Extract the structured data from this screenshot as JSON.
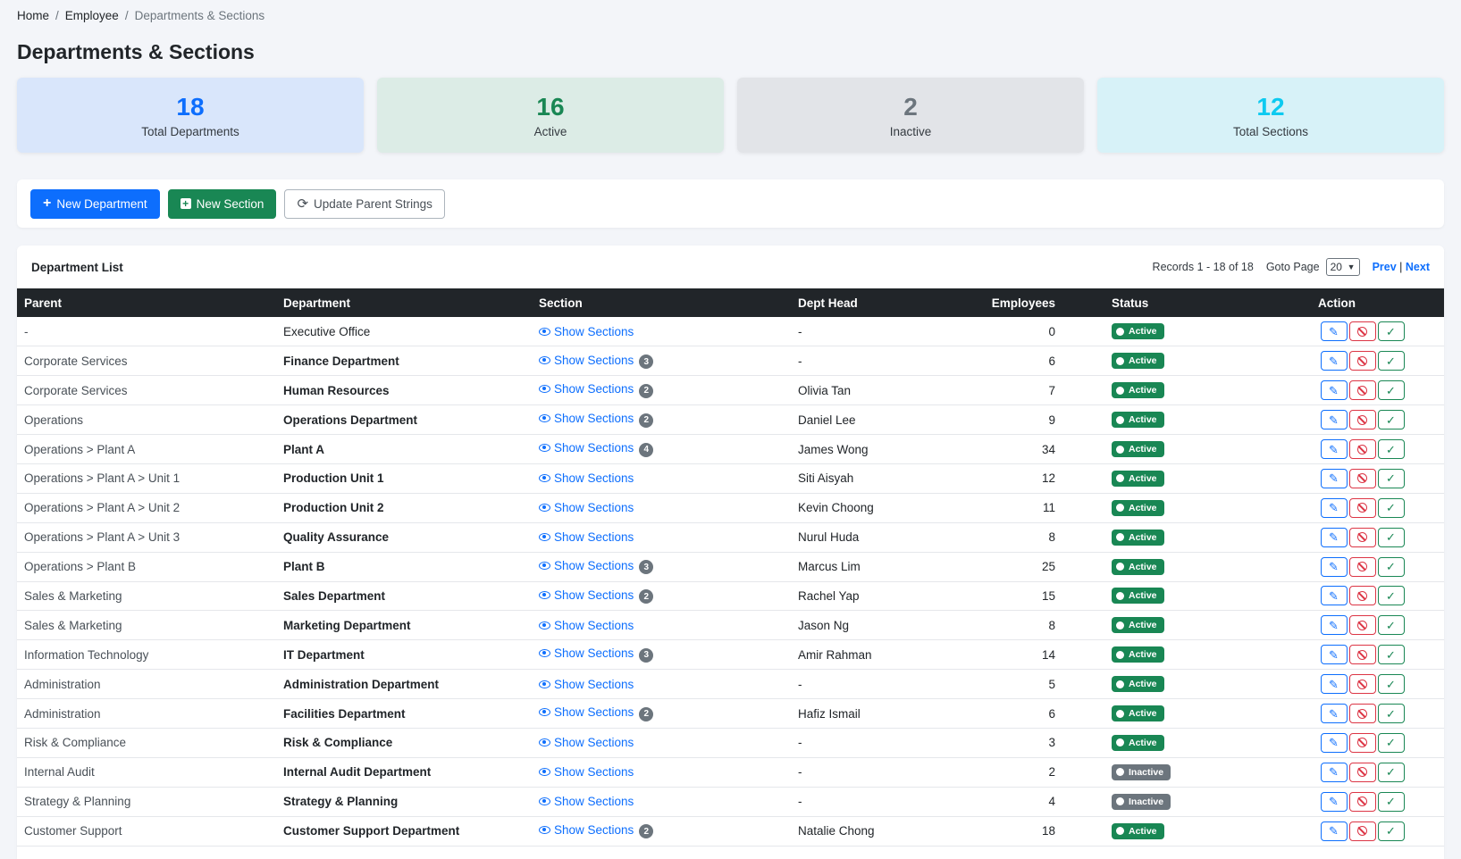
{
  "breadcrumb": {
    "home": "Home",
    "employee": "Employee",
    "current": "Departments & Sections",
    "separator": "/"
  },
  "page_title": "Departments & Sections",
  "stats": [
    {
      "value": "18",
      "label": "Total Departments",
      "color": "#0d6efd"
    },
    {
      "value": "16",
      "label": "Active",
      "color": "#198754"
    },
    {
      "value": "2",
      "label": "Inactive",
      "color": "#6c757d"
    },
    {
      "value": "12",
      "label": "Total Sections",
      "color": "#0dcaf0"
    }
  ],
  "toolbar": {
    "new_department": "New Department",
    "new_section": "New Section",
    "update_parent": "Update Parent Strings"
  },
  "list": {
    "title": "Department List",
    "records": "Records 1 - 18 of 18",
    "goto_label": "Goto Page",
    "page_size": "20",
    "prev": "Prev",
    "pager_sep": "|",
    "next": "Next"
  },
  "columns": {
    "parent": "Parent",
    "department": "Department",
    "section": "Section",
    "dept_head": "Dept Head",
    "employees": "Employees",
    "status": "Status",
    "action": "Action"
  },
  "show_sections_label": "Show Sections",
  "rows": [
    {
      "parent": "-",
      "department": "Executive Office",
      "bold": false,
      "sections": "",
      "head": "-",
      "employees": "0",
      "status": "Active"
    },
    {
      "parent": "Corporate Services",
      "department": "Finance Department",
      "bold": true,
      "sections": "3",
      "head": "-",
      "employees": "6",
      "status": "Active"
    },
    {
      "parent": "Corporate Services",
      "department": "Human Resources",
      "bold": true,
      "sections": "2",
      "head": "Olivia Tan",
      "employees": "7",
      "status": "Active"
    },
    {
      "parent": "Operations",
      "department": "Operations Department",
      "bold": true,
      "sections": "2",
      "head": "Daniel Lee",
      "employees": "9",
      "status": "Active"
    },
    {
      "parent": "Operations > Plant A",
      "department": "Plant A",
      "bold": true,
      "sections": "4",
      "head": "James Wong",
      "employees": "34",
      "status": "Active"
    },
    {
      "parent": "Operations > Plant A > Unit 1",
      "department": "Production Unit 1",
      "bold": true,
      "sections": "",
      "head": "Siti Aisyah",
      "employees": "12",
      "status": "Active"
    },
    {
      "parent": "Operations > Plant A > Unit 2",
      "department": "Production Unit 2",
      "bold": true,
      "sections": "",
      "head": "Kevin Choong",
      "employees": "11",
      "status": "Active"
    },
    {
      "parent": "Operations > Plant A > Unit 3",
      "department": "Quality Assurance",
      "bold": true,
      "sections": "",
      "head": "Nurul Huda",
      "employees": "8",
      "status": "Active"
    },
    {
      "parent": "Operations > Plant B",
      "department": "Plant B",
      "bold": true,
      "sections": "3",
      "head": "Marcus Lim",
      "employees": "25",
      "status": "Active"
    },
    {
      "parent": "Sales & Marketing",
      "department": "Sales Department",
      "bold": true,
      "sections": "2",
      "head": "Rachel Yap",
      "employees": "15",
      "status": "Active"
    },
    {
      "parent": "Sales & Marketing",
      "department": "Marketing Department",
      "bold": true,
      "sections": "",
      "head": "Jason Ng",
      "employees": "8",
      "status": "Active"
    },
    {
      "parent": "Information Technology",
      "department": "IT Department",
      "bold": true,
      "sections": "3",
      "head": "Amir Rahman",
      "employees": "14",
      "status": "Active"
    },
    {
      "parent": "Administration",
      "department": "Administration Department",
      "bold": true,
      "sections": "",
      "head": "-",
      "employees": "5",
      "status": "Active"
    },
    {
      "parent": "Administration",
      "department": "Facilities Department",
      "bold": true,
      "sections": "2",
      "head": "Hafiz Ismail",
      "employees": "6",
      "status": "Active"
    },
    {
      "parent": "Risk & Compliance",
      "department": "Risk & Compliance",
      "bold": true,
      "sections": "",
      "head": "-",
      "employees": "3",
      "status": "Active"
    },
    {
      "parent": "Internal Audit",
      "department": "Internal Audit Department",
      "bold": true,
      "sections": "",
      "head": "-",
      "employees": "2",
      "status": "Inactive"
    },
    {
      "parent": "Strategy & Planning",
      "department": "Strategy & Planning",
      "bold": true,
      "sections": "",
      "head": "-",
      "employees": "4",
      "status": "Inactive"
    },
    {
      "parent": "Customer Support",
      "department": "Customer Support Department",
      "bold": true,
      "sections": "2",
      "head": "Natalie Chong",
      "employees": "18",
      "status": "Active"
    }
  ],
  "colors": {
    "primary": "#0d6efd",
    "success": "#198754",
    "danger": "#dc3545",
    "secondary": "#6c757d",
    "header_bg": "#212529"
  },
  "icons": {
    "edit": "edit-icon",
    "disable": "ban-icon",
    "activate": "check-icon",
    "view": "eye-icon"
  }
}
